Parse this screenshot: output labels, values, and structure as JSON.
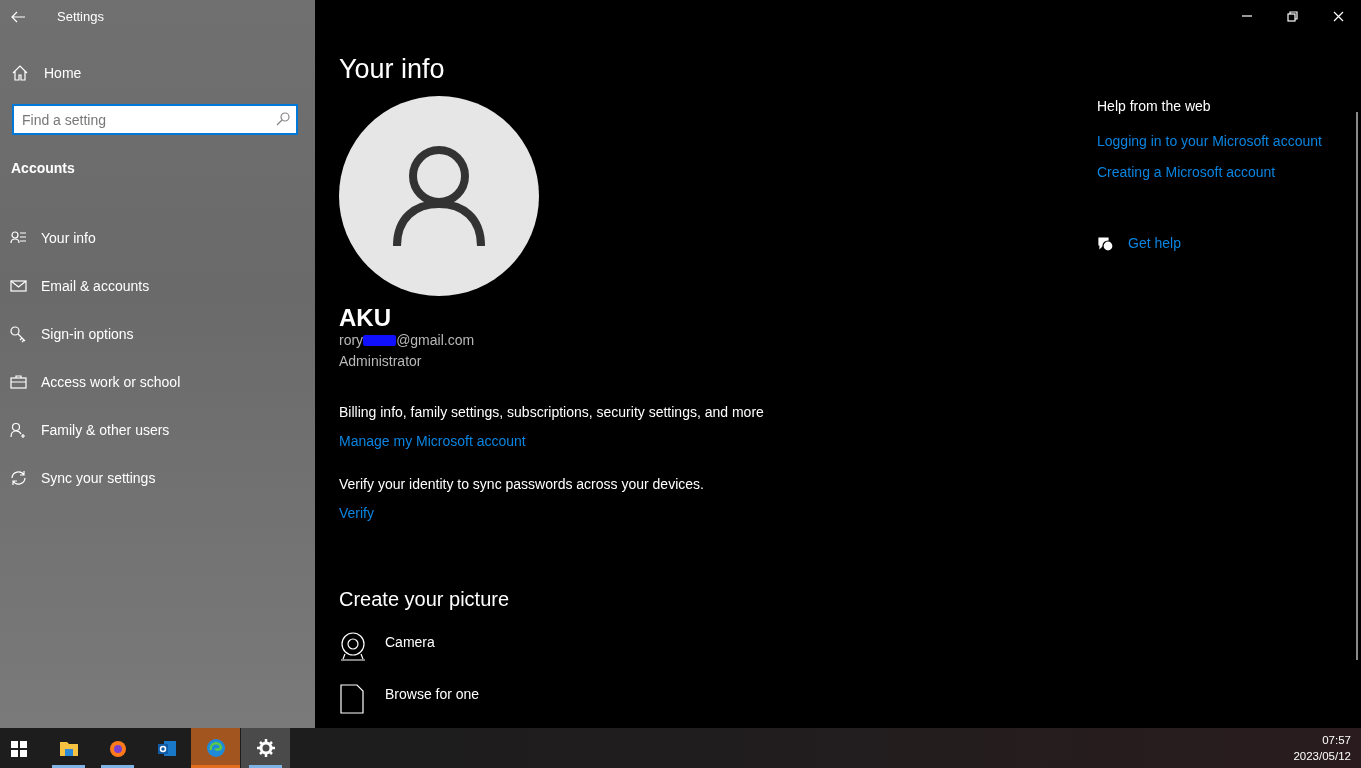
{
  "window": {
    "title": "Settings",
    "controls": [
      {
        "kind": "minimize"
      },
      {
        "kind": "restore"
      },
      {
        "kind": "close"
      }
    ]
  },
  "sidebar": {
    "home": "Home",
    "search": {
      "placeholder": "Find a setting"
    },
    "section": "Accounts",
    "items": [
      {
        "label": "Your info",
        "kind": "person-list"
      },
      {
        "label": "Email & accounts",
        "kind": "mail"
      },
      {
        "label": "Sign-in options",
        "kind": "key"
      },
      {
        "label": "Access work or school",
        "kind": "briefcase"
      },
      {
        "label": "Family & other users",
        "kind": "person-add"
      },
      {
        "label": "Sync your settings",
        "kind": "sync"
      }
    ]
  },
  "main": {
    "title": "Your info",
    "name": "AKU",
    "email_start": "rory",
    "email_end": "@gmail.com",
    "role": "Administrator",
    "blocks": [
      {
        "text": "Billing info, family settings, subscriptions, security settings, and more",
        "link": "Manage my Microsoft account"
      },
      {
        "text": "Verify your identity to sync passwords across your devices.",
        "link": "Verify"
      }
    ],
    "picture_heading": "Create your picture",
    "picture_options": [
      {
        "label": "Camera",
        "kind": "camera"
      },
      {
        "label": "Browse for one",
        "kind": "file"
      }
    ]
  },
  "help": {
    "heading": "Help from the web",
    "links": [
      "Logging in to your Microsoft account",
      "Creating a Microsoft account"
    ],
    "get_help": "Get help"
  },
  "taskbar": {
    "apps": [
      {
        "kind": "start",
        "running": false,
        "attention": false,
        "selected": false
      },
      {
        "kind": "folder",
        "running": true,
        "attention": false,
        "selected": false
      },
      {
        "kind": "browser",
        "running": true,
        "attention": false,
        "selected": false
      },
      {
        "kind": "mail",
        "running": false,
        "attention": false,
        "selected": false
      },
      {
        "kind": "edge",
        "running": true,
        "attention": true,
        "selected": false
      },
      {
        "kind": "gear",
        "running": true,
        "attention": false,
        "selected": true
      }
    ],
    "time": "07:57",
    "date": "2023/05/12"
  }
}
